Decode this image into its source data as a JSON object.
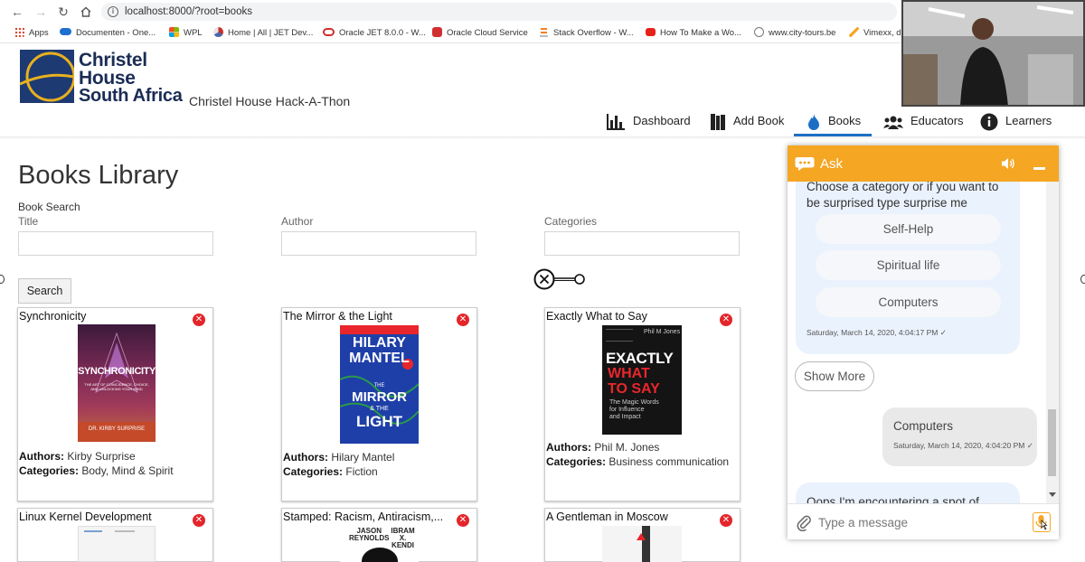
{
  "browser": {
    "url": "localhost:8000/?root=books",
    "bookmarks": [
      {
        "label": "Apps",
        "icon": "apps-grid-icon",
        "color": "#e0462b"
      },
      {
        "label": "Documenten - One...",
        "icon": "onedrive-cloud-icon",
        "color": "#1d6fd1"
      },
      {
        "label": "WPL",
        "icon": "windows-logo-icon",
        "color": "#2e9d45"
      },
      {
        "label": "Home | All | JET Dev...",
        "icon": "jet-logo-icon",
        "color": "#c9302c"
      },
      {
        "label": "Oracle JET 8.0.0 - W...",
        "icon": "oracle-ring-icon",
        "color": "#d12f2f"
      },
      {
        "label": "Oracle Cloud Service",
        "icon": "oracle-cloud-icon",
        "color": "#d12f2f"
      },
      {
        "label": "Stack Overflow - W...",
        "icon": "stackoverflow-icon",
        "color": "#f48024"
      },
      {
        "label": "How To Make a Wo...",
        "icon": "youtube-icon",
        "color": "#e62117"
      },
      {
        "label": "www.city-tours.be",
        "icon": "globe-icon",
        "color": "#777777"
      },
      {
        "label": "Vimexx, d",
        "icon": "vimexx-icon",
        "color": "#f5a623"
      }
    ]
  },
  "header": {
    "logo_line1": "Christel",
    "logo_line2": "House",
    "logo_line3": "South Africa",
    "app_title": "Christel House Hack-A-Thon",
    "nav": [
      {
        "label": "Dashboard",
        "icon": "bar-chart-icon"
      },
      {
        "label": "Add Book",
        "icon": "books-icon"
      },
      {
        "label": "Books",
        "icon": "flame-icon",
        "active": true
      },
      {
        "label": "Educators",
        "icon": "group-icon"
      },
      {
        "label": "Learners",
        "icon": "info-icon"
      }
    ],
    "accent_color": "#1c6fc4"
  },
  "main": {
    "page_title": "Books Library",
    "search_heading": "Book Search",
    "fields": {
      "title_label": "Title",
      "author_label": "Author",
      "categories_label": "Categories"
    },
    "search_button": "Search",
    "books": [
      {
        "title": "Synchronicity",
        "authors_label": "Authors:",
        "authors": "Kirby Surprise",
        "categories_label": "Categories:",
        "categories": "Body, Mind & Spirit",
        "cover_title": "SYNCHRONICITY",
        "cover_subtitle": "THE ART OF COINCIDENCE, CHOICE, AND UNLOCKING YOUR MIND",
        "cover_author": "DR. KIRBY SURPRISE"
      },
      {
        "title": "The Mirror & the Light",
        "authors_label": "Authors:",
        "authors": "Hilary Mantel",
        "categories_label": "Categories:",
        "categories": "Fiction",
        "cover_line1": "HILARY",
        "cover_line2": "MANTEL",
        "cover_line3": "THE",
        "cover_line4": "MIRROR",
        "cover_line5": "& THE",
        "cover_line6": "LIGHT"
      },
      {
        "title": "Exactly What to Say",
        "authors_label": "Authors:",
        "authors": "Phil M. Jones",
        "categories_label": "Categories:",
        "categories": "Business communication",
        "cover_author": "Phil M Jones",
        "cover_line1": "EXACTLY",
        "cover_line2": "WHAT",
        "cover_line3": "TO SAY",
        "cover_sub1": "The Magic Words",
        "cover_sub2": "for Influence",
        "cover_sub3": "and Impact"
      },
      {
        "title": "Linux Kernel Development"
      },
      {
        "title": "Stamped: Racism, Antiracism,...",
        "cover_author1": "JASON",
        "cover_author1b": "REYNOLDS",
        "cover_author2": "IBRAM X.",
        "cover_author2b": "KENDI"
      },
      {
        "title": "A Gentleman in Moscow"
      }
    ]
  },
  "chat": {
    "title": "Ask",
    "header_color": "#f5a623",
    "prompt": "Choose a category or if you want to be surprised type surprise me",
    "prompt_line1": "Choose a category or if you want to",
    "prompt_line2": "be surprised type surprise me",
    "choices": [
      "Self-Help",
      "Spiritual life",
      "Computers"
    ],
    "bot_timestamp": "Saturday, March 14, 2020, 4:04:17 PM",
    "show_more": "Show More",
    "user_message": "Computers",
    "user_timestamp": "Saturday, March 14, 2020, 4:04:20 PM",
    "next_bot_message": "Oops I'm encountering a spot of",
    "input_placeholder": "Type a message"
  }
}
